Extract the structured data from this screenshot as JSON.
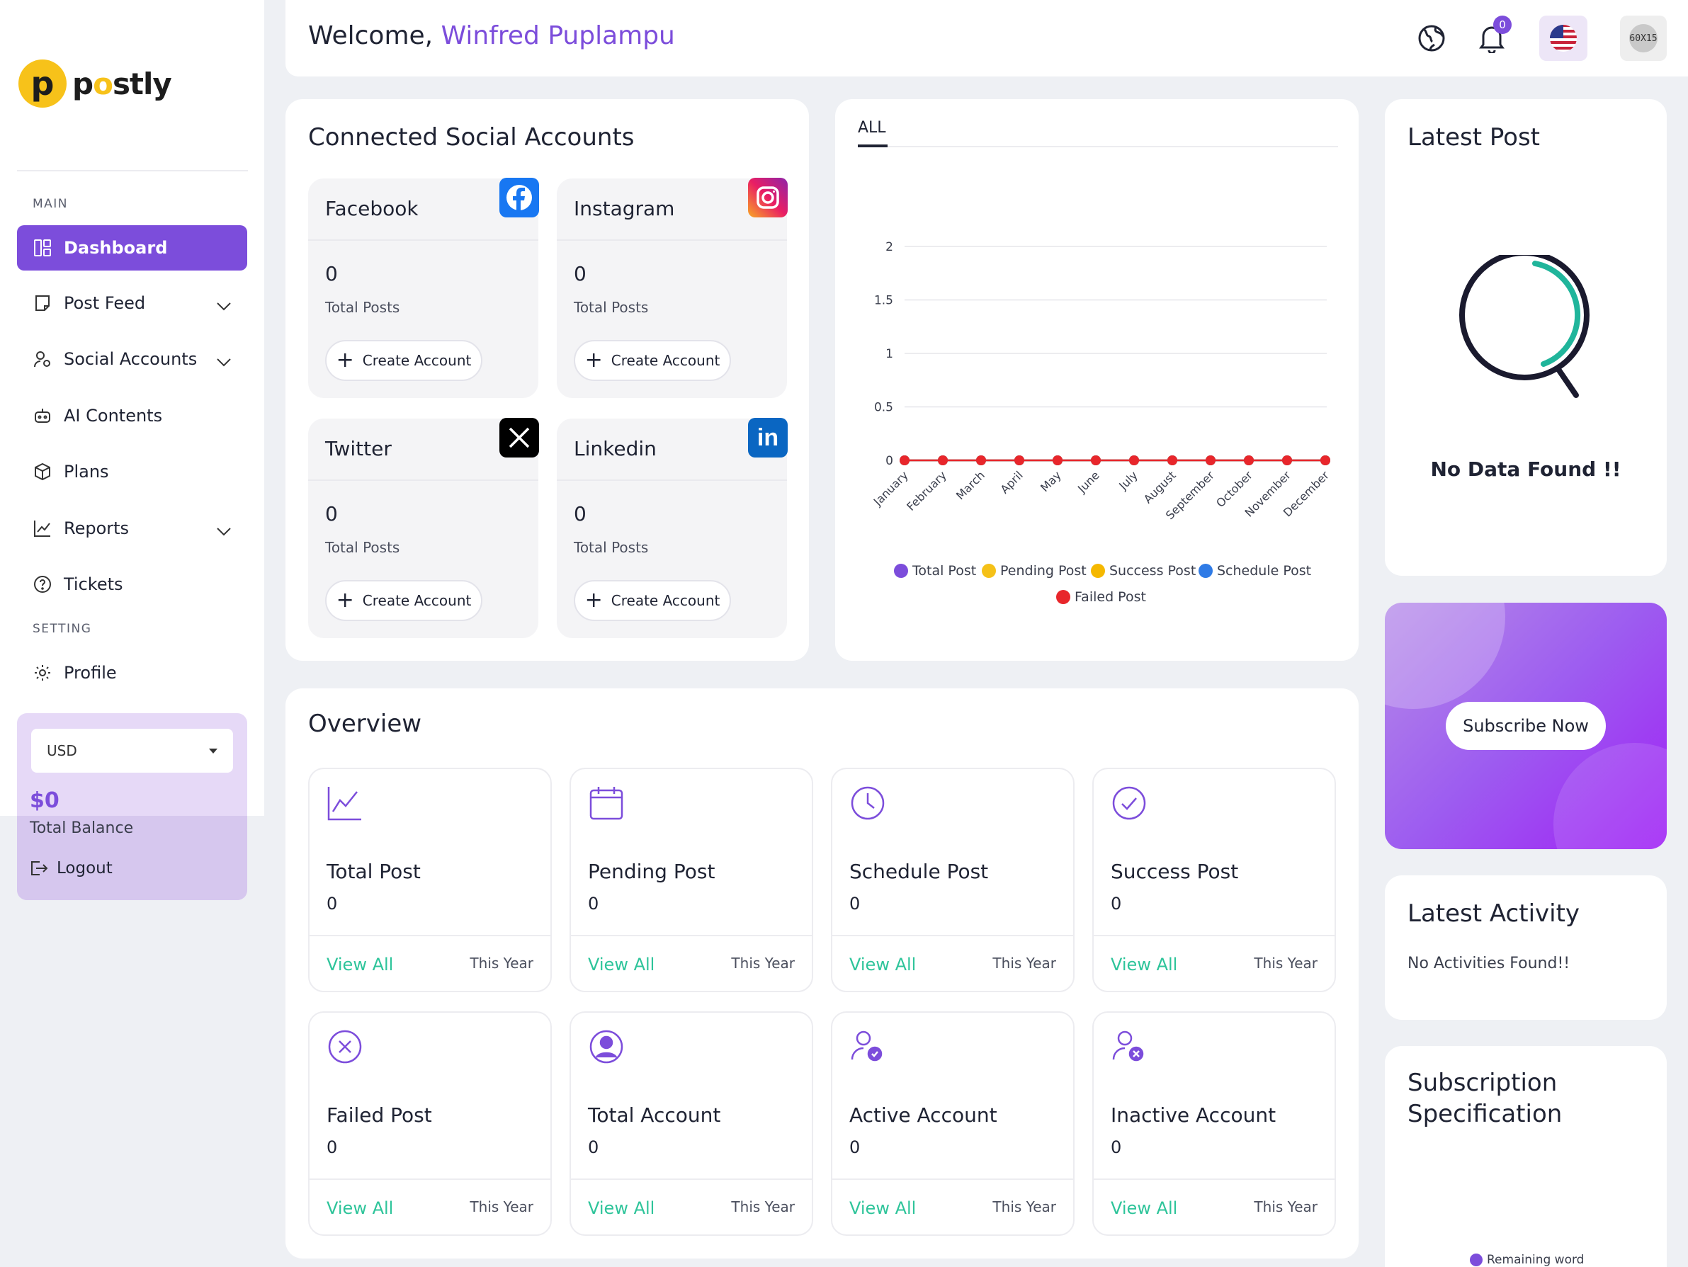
{
  "brand": {
    "name_p": "p",
    "name_o": "o",
    "name_rest": "stly",
    "logo_letter": "p"
  },
  "header": {
    "welcome_prefix": "Welcome,",
    "user_name": "Winfred Puplampu",
    "notification_count": "0",
    "avatar_text": "60X15"
  },
  "sidebar": {
    "section_main": "MAIN",
    "section_setting": "SETTING",
    "items": [
      {
        "label": "Dashboard",
        "icon": "dashboard-icon"
      },
      {
        "label": "Post Feed",
        "icon": "post-feed-icon"
      },
      {
        "label": "Social Accounts",
        "icon": "social-accounts-icon"
      },
      {
        "label": "AI Contents",
        "icon": "robot-icon"
      },
      {
        "label": "Plans",
        "icon": "box-icon"
      },
      {
        "label": "Reports",
        "icon": "chart-line-icon"
      },
      {
        "label": "Tickets",
        "icon": "question-circle-icon"
      },
      {
        "label": "Profile",
        "icon": "gear-icon"
      }
    ],
    "currency": "USD",
    "balance_amount": "$0",
    "balance_label": "Total Balance",
    "logout_label": "Logout"
  },
  "connected": {
    "title": "Connected Social Accounts",
    "accounts": [
      {
        "name": "Facebook",
        "count": "0",
        "label": "Total Posts",
        "button": "Create Account"
      },
      {
        "name": "Instagram",
        "count": "0",
        "label": "Total Posts",
        "button": "Create Account"
      },
      {
        "name": "Twitter",
        "count": "0",
        "label": "Total Posts",
        "button": "Create Account"
      },
      {
        "name": "Linkedin",
        "count": "0",
        "label": "Total Posts",
        "button": "Create Account"
      }
    ]
  },
  "chart_tab": "ALL",
  "chart_data": {
    "type": "line",
    "categories": [
      "January",
      "February",
      "March",
      "April",
      "May",
      "June",
      "July",
      "August",
      "September",
      "October",
      "November",
      "December"
    ],
    "yticks": [
      "0",
      "0.5",
      "1",
      "1.5",
      "2"
    ],
    "ylim": [
      0,
      2
    ],
    "grid": true,
    "legend_position": "bottom",
    "series": [
      {
        "name": "Total Post",
        "color": "#7c4ddb",
        "values": [
          0,
          0,
          0,
          0,
          0,
          0,
          0,
          0,
          0,
          0,
          0,
          0
        ]
      },
      {
        "name": "Pending Post",
        "color": "#f5c118",
        "values": [
          0,
          0,
          0,
          0,
          0,
          0,
          0,
          0,
          0,
          0,
          0,
          0
        ]
      },
      {
        "name": "Success Post",
        "color": "#f5b800",
        "values": [
          0,
          0,
          0,
          0,
          0,
          0,
          0,
          0,
          0,
          0,
          0,
          0
        ]
      },
      {
        "name": "Schedule Post",
        "color": "#2f7be6",
        "values": [
          0,
          0,
          0,
          0,
          0,
          0,
          0,
          0,
          0,
          0,
          0,
          0
        ]
      },
      {
        "name": "Failed Post",
        "color": "#e8262b",
        "values": [
          0,
          0,
          0,
          0,
          0,
          0,
          0,
          0,
          0,
          0,
          0,
          0
        ]
      }
    ]
  },
  "latest_post": {
    "title": "Latest Post",
    "empty": "No Data Found !!"
  },
  "subscribe": {
    "button": "Subscribe Now"
  },
  "latest_activity": {
    "title": "Latest Activity",
    "empty": "No Activities Found!!"
  },
  "subscription": {
    "title_line1": "Subscription",
    "title_line2": "Specification",
    "legend": "Remaining word"
  },
  "overview": {
    "title": "Overview",
    "link_label": "View All",
    "period_label": "This Year",
    "stats": [
      {
        "title": "Total Post",
        "value": "0",
        "icon": "chart-line-icon"
      },
      {
        "title": "Pending Post",
        "value": "0",
        "icon": "calendar-icon"
      },
      {
        "title": "Schedule Post",
        "value": "0",
        "icon": "clock-icon"
      },
      {
        "title": "Success Post",
        "value": "0",
        "icon": "check-circle-icon"
      },
      {
        "title": "Failed Post",
        "value": "0",
        "icon": "x-circle-icon"
      },
      {
        "title": "Total Account",
        "value": "0",
        "icon": "user-circle-icon"
      },
      {
        "title": "Active Account",
        "value": "0",
        "icon": "user-check-icon"
      },
      {
        "title": "Inactive Account",
        "value": "0",
        "icon": "user-x-icon"
      }
    ]
  },
  "colors": {
    "accent": "#7c4ddb",
    "link": "#2ec49a",
    "failed": "#e8262b"
  }
}
